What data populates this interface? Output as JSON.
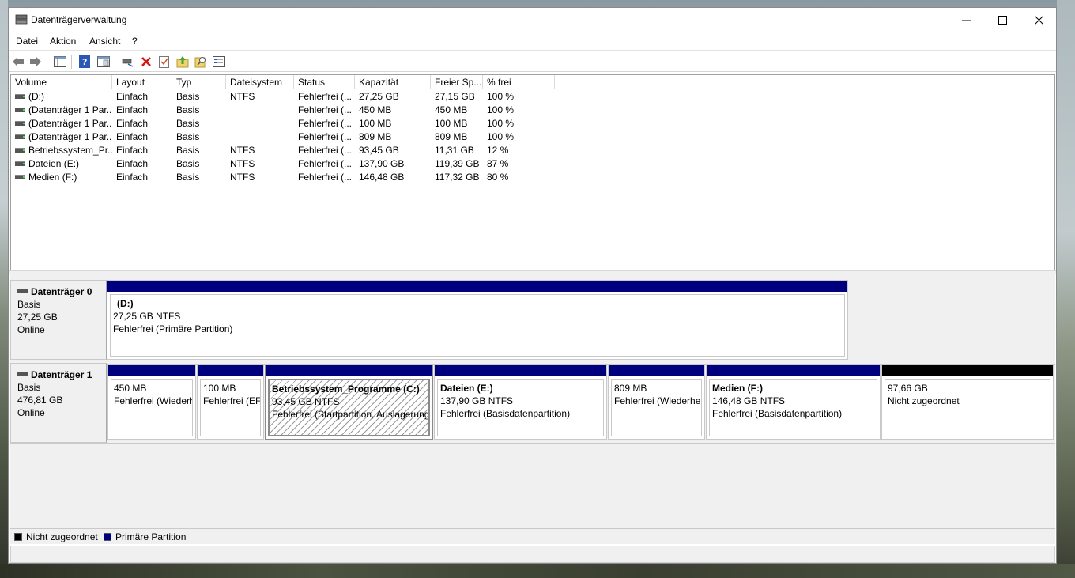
{
  "window": {
    "title": "Datenträgerverwaltung"
  },
  "menu": [
    "Datei",
    "Aktion",
    "Ansicht",
    "?"
  ],
  "toolbar": {
    "icons": [
      "back-arrow-icon",
      "forward-arrow-icon",
      "properties-grid-icon",
      "help-icon",
      "view-pane-icon",
      "connect-icon",
      "delete-icon",
      "check-icon",
      "folder-up-icon",
      "search-icon",
      "properties-icon"
    ]
  },
  "volume_list": {
    "columns": [
      "Volume",
      "Layout",
      "Typ",
      "Dateisystem",
      "Status",
      "Kapazität",
      "Freier Sp...",
      "% frei"
    ],
    "rows": [
      {
        "volume": "(D:)",
        "layout": "Einfach",
        "typ": "Basis",
        "fs": "NTFS",
        "status": "Fehlerfrei (...",
        "kap": "27,25 GB",
        "frei": "27,15 GB",
        "pct": "100 %"
      },
      {
        "volume": "(Datenträger 1 Par...",
        "layout": "Einfach",
        "typ": "Basis",
        "fs": "",
        "status": "Fehlerfrei (...",
        "kap": "450 MB",
        "frei": "450 MB",
        "pct": "100 %"
      },
      {
        "volume": "(Datenträger 1 Par...",
        "layout": "Einfach",
        "typ": "Basis",
        "fs": "",
        "status": "Fehlerfrei (...",
        "kap": "100 MB",
        "frei": "100 MB",
        "pct": "100 %"
      },
      {
        "volume": "(Datenträger 1 Par...",
        "layout": "Einfach",
        "typ": "Basis",
        "fs": "",
        "status": "Fehlerfrei (...",
        "kap": "809 MB",
        "frei": "809 MB",
        "pct": "100 %"
      },
      {
        "volume": "Betriebssystem_Pr...",
        "layout": "Einfach",
        "typ": "Basis",
        "fs": "NTFS",
        "status": "Fehlerfrei (...",
        "kap": "93,45 GB",
        "frei": "11,31 GB",
        "pct": "12 %"
      },
      {
        "volume": "Dateien (E:)",
        "layout": "Einfach",
        "typ": "Basis",
        "fs": "NTFS",
        "status": "Fehlerfrei (...",
        "kap": "137,90 GB",
        "frei": "119,39 GB",
        "pct": "87 %"
      },
      {
        "volume": "Medien (F:)",
        "layout": "Einfach",
        "typ": "Basis",
        "fs": "NTFS",
        "status": "Fehlerfrei (...",
        "kap": "146,48 GB",
        "frei": "117,32 GB",
        "pct": "80 %"
      }
    ]
  },
  "disks": [
    {
      "name": "Datenträger 0",
      "type": "Basis",
      "size": "27,25 GB",
      "state": "Online",
      "partitions": [
        {
          "title": "(D:)",
          "line1": "27,25 GB NTFS",
          "line2": "Fehlerfrei (Primäre Partition)"
        }
      ]
    },
    {
      "name": "Datenträger 1",
      "type": "Basis",
      "size": "476,81 GB",
      "state": "Online",
      "partitions": [
        {
          "title": "",
          "line1": "450 MB",
          "line2": "Fehlerfrei (Wiederh"
        },
        {
          "title": "",
          "line1": "100 MB",
          "line2": "Fehlerfrei (EFI"
        },
        {
          "title": "Betriebssystem_Programme  (C:)",
          "line1": "93,45 GB NTFS",
          "line2": "Fehlerfrei (Startpartition, Auslagerung"
        },
        {
          "title": "Dateien  (E:)",
          "line1": "137,90 GB NTFS",
          "line2": "Fehlerfrei (Basisdatenpartition)"
        },
        {
          "title": "",
          "line1": "809 MB",
          "line2": "Fehlerfrei (Wiederhe"
        },
        {
          "title": "Medien  (F:)",
          "line1": "146,48 GB NTFS",
          "line2": "Fehlerfrei (Basisdatenpartition)"
        },
        {
          "title": "",
          "line1": "97,66 GB",
          "line2": "Nicht zugeordnet"
        }
      ]
    }
  ],
  "legend": {
    "unallocated": {
      "label": "Nicht zugeordnet",
      "color": "#000000"
    },
    "primary": {
      "label": "Primäre Partition",
      "color": "#00007f"
    }
  }
}
